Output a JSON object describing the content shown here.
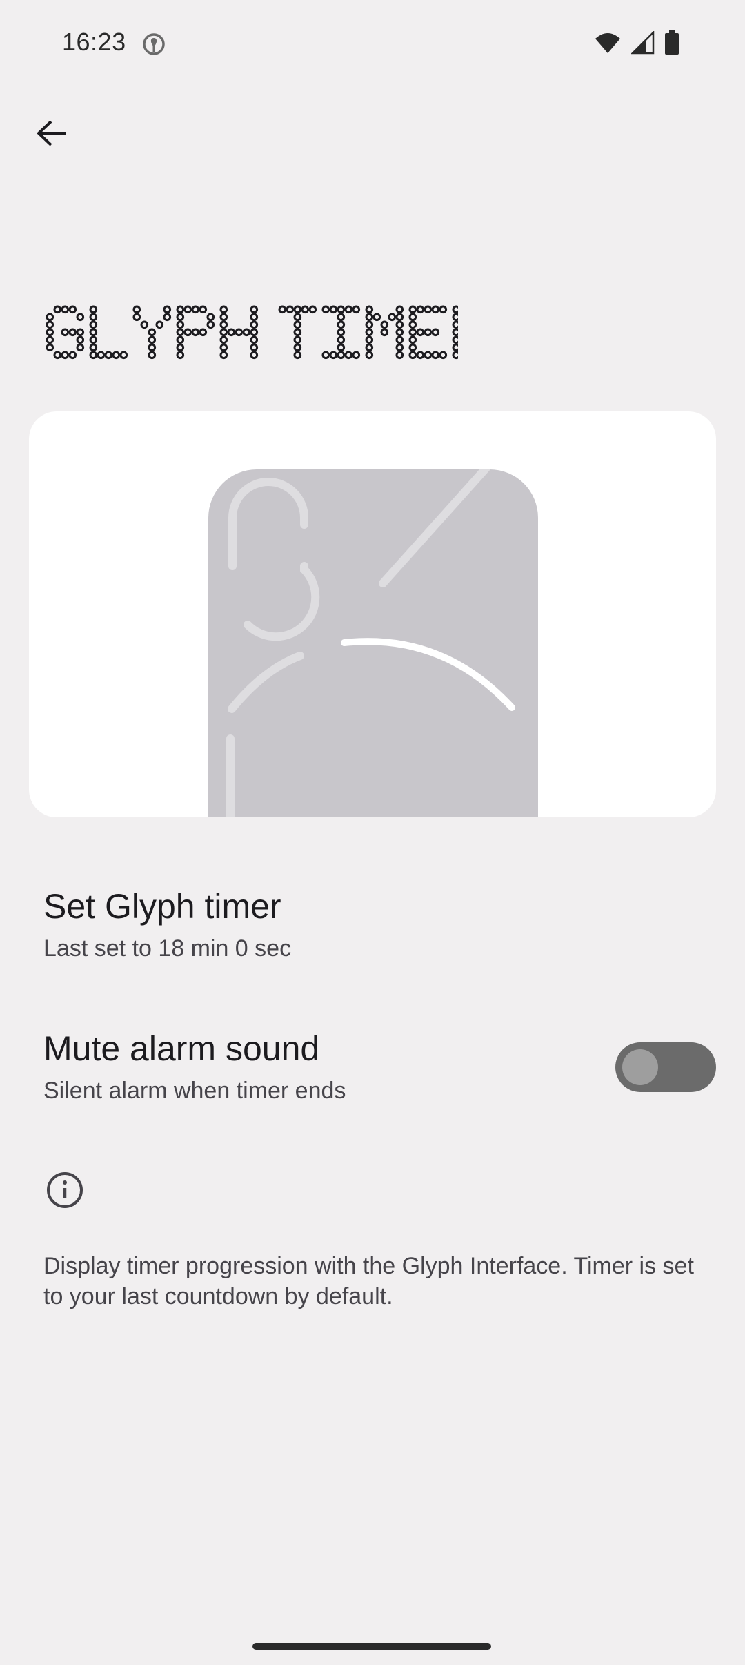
{
  "status_bar": {
    "time": "16:23",
    "notification_icon": "maps-pin-icon",
    "right_icons": [
      "wifi-icon",
      "signal-icon",
      "battery-icon"
    ]
  },
  "header": {
    "back_icon": "arrow-back-icon",
    "title": "GLYPH TIMER"
  },
  "preview": {
    "image": "glyph-interface-phone-back"
  },
  "settings": {
    "set_timer": {
      "title": "Set Glyph timer",
      "subtitle": "Last set to 18 min 0 sec"
    },
    "mute_alarm": {
      "title": "Mute alarm sound",
      "subtitle": "Silent alarm when timer ends",
      "enabled": false
    }
  },
  "info": {
    "icon": "info-icon",
    "text": "Display timer progression with the Glyph Interface. Timer is set to your last countdown by default."
  },
  "colors": {
    "background": "#f1eff0",
    "card": "#ffffff",
    "phone": "#c8c6cb",
    "toggle_off_track": "#6b6b6b"
  }
}
